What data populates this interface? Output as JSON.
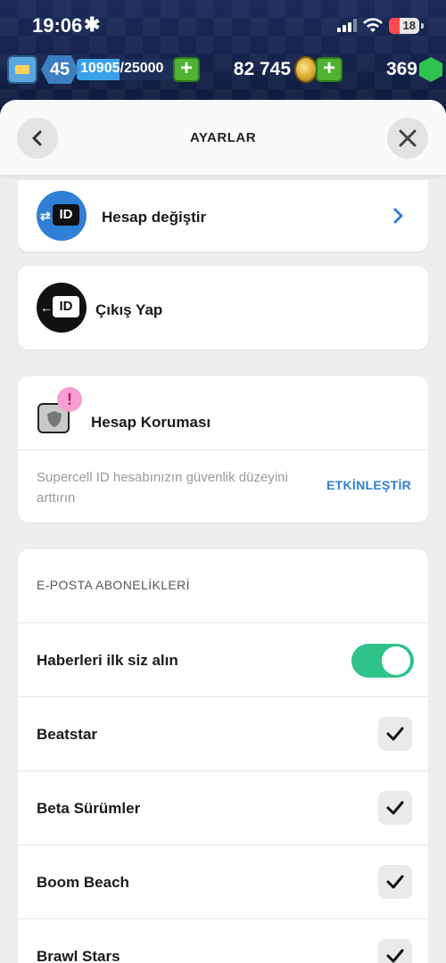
{
  "status_bar": {
    "time": "19:06",
    "time_suffix": "✱",
    "battery": "18"
  },
  "hud": {
    "level": "45",
    "xp": "10905/25000",
    "xp_progress": 0.436,
    "gold": "82 745",
    "gems": "369",
    "plus": "+"
  },
  "header": {
    "title": "AYARLAR"
  },
  "account": {
    "switch_label": "Hesap değiştir",
    "logout_label": "Çıkış Yap",
    "id_badge": "ID"
  },
  "protection": {
    "title": "Hesap Koruması",
    "alert": "!",
    "description": "Supercell ID hesabınızın güvenlik düzeyini arttırın",
    "action": "ETKİNLEŞTİR"
  },
  "email": {
    "section_title": "E-POSTA ABONELİKLERİ",
    "first_row": {
      "label": "Haberleri ilk siz alın",
      "enabled": true
    },
    "items": [
      {
        "label": "Beatstar",
        "checked": true
      },
      {
        "label": "Beta Sürümler",
        "checked": true
      },
      {
        "label": "Boom Beach",
        "checked": true
      },
      {
        "label": "Brawl Stars",
        "checked": true
      }
    ]
  },
  "colors": {
    "accent_blue": "#2f7fd6",
    "toggle_green": "#2fc38a",
    "alert_pink": "#f79fd3"
  }
}
